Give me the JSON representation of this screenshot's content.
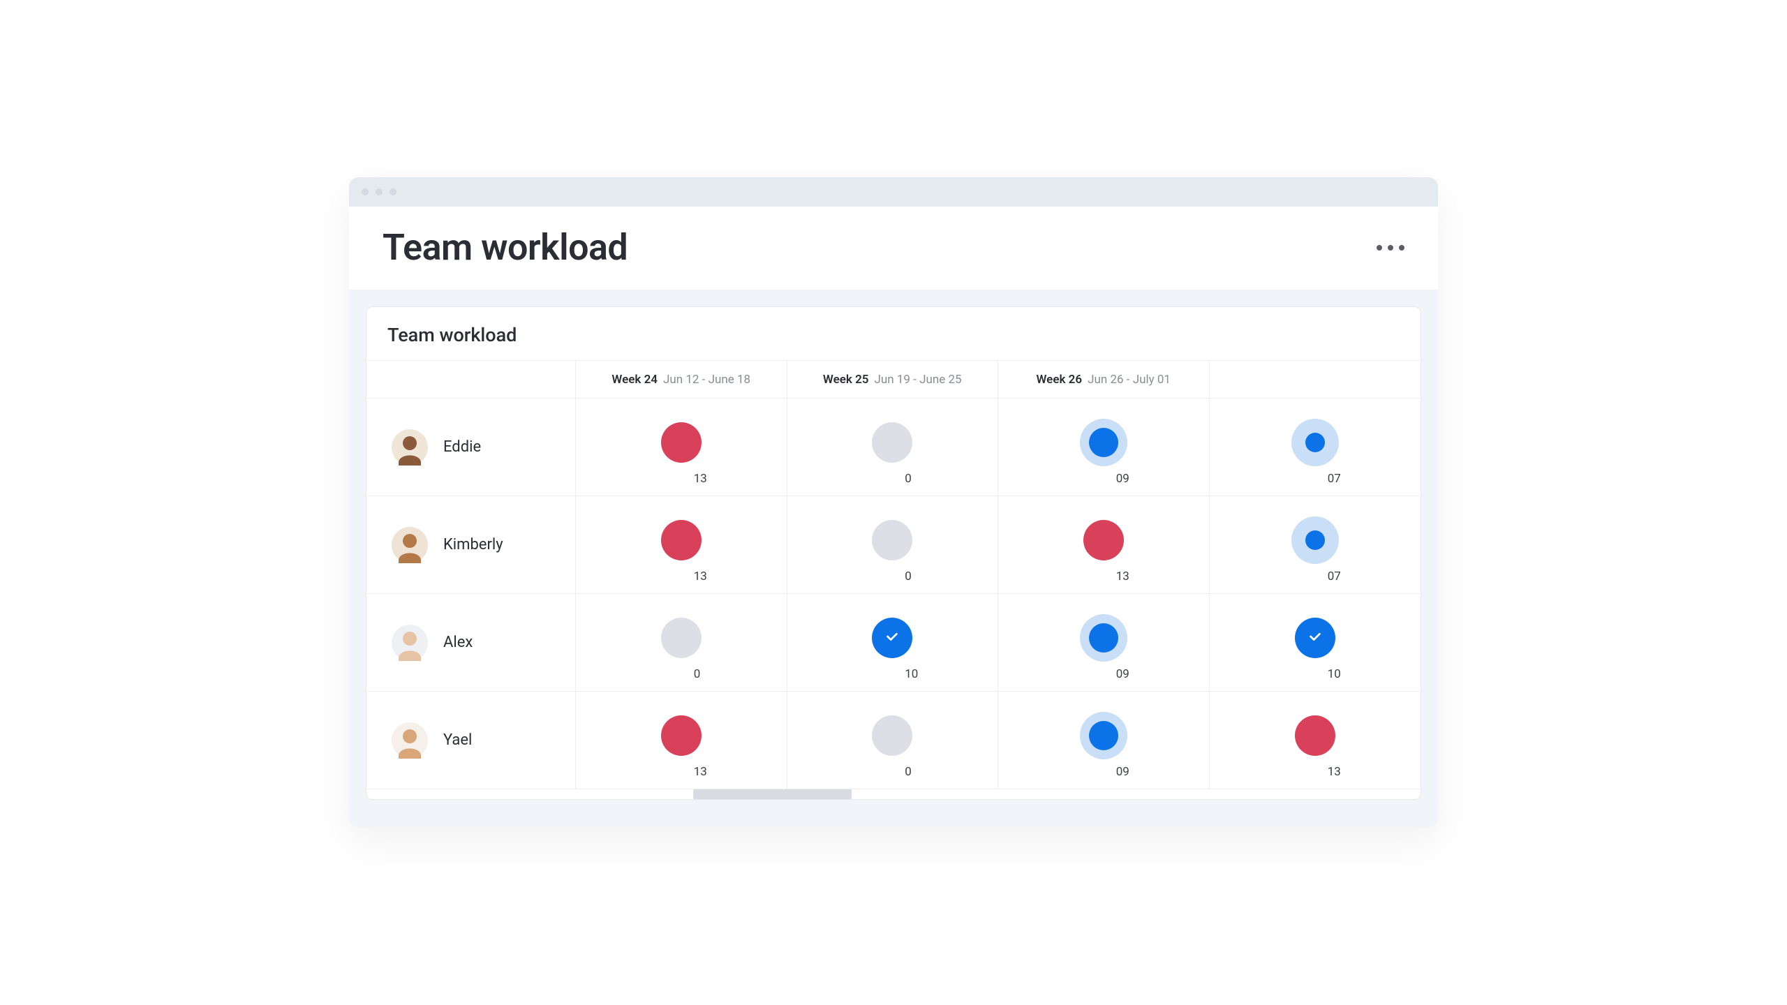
{
  "header": {
    "title": "Team workload"
  },
  "card": {
    "title": "Team workload"
  },
  "columns": [
    {
      "week": "Week 24",
      "range": "Jun 12 - June 18"
    },
    {
      "week": "Week 25",
      "range": "Jun 19 - June 25"
    },
    {
      "week": "Week 26",
      "range": "Jun 26 - July 01"
    }
  ],
  "colors": {
    "red": "#d9415a",
    "blue": "#0b72e7",
    "halo": "#c9def7",
    "grey": "#dedfe6"
  },
  "members": [
    {
      "name": "Eddie",
      "avatar_bg": "#f0e6d8",
      "avatar_skin": "#8a5a3a",
      "cells": [
        {
          "value": "13",
          "style": "red"
        },
        {
          "value": "0",
          "style": "grey"
        },
        {
          "value": "09",
          "style": "blue-halo"
        },
        {
          "value": "07",
          "style": "blue-halo-small"
        }
      ]
    },
    {
      "name": "Kimberly",
      "avatar_bg": "#efe3d5",
      "avatar_skin": "#b37948",
      "cells": [
        {
          "value": "13",
          "style": "red"
        },
        {
          "value": "0",
          "style": "grey"
        },
        {
          "value": "13",
          "style": "red"
        },
        {
          "value": "07",
          "style": "blue-halo-small"
        }
      ]
    },
    {
      "name": "Alex",
      "avatar_bg": "#eef0f4",
      "avatar_skin": "#e6c3a5",
      "cells": [
        {
          "value": "0",
          "style": "grey"
        },
        {
          "value": "10",
          "style": "blue-check"
        },
        {
          "value": "09",
          "style": "blue-halo"
        },
        {
          "value": "10",
          "style": "blue-check"
        }
      ]
    },
    {
      "name": "Yael",
      "avatar_bg": "#f5f0ea",
      "avatar_skin": "#d9a679",
      "cells": [
        {
          "value": "13",
          "style": "red"
        },
        {
          "value": "0",
          "style": "grey"
        },
        {
          "value": "09",
          "style": "blue-halo"
        },
        {
          "value": "13",
          "style": "red"
        }
      ]
    }
  ],
  "scrollbar": {
    "left_pct": 31,
    "width_pct": 15
  }
}
